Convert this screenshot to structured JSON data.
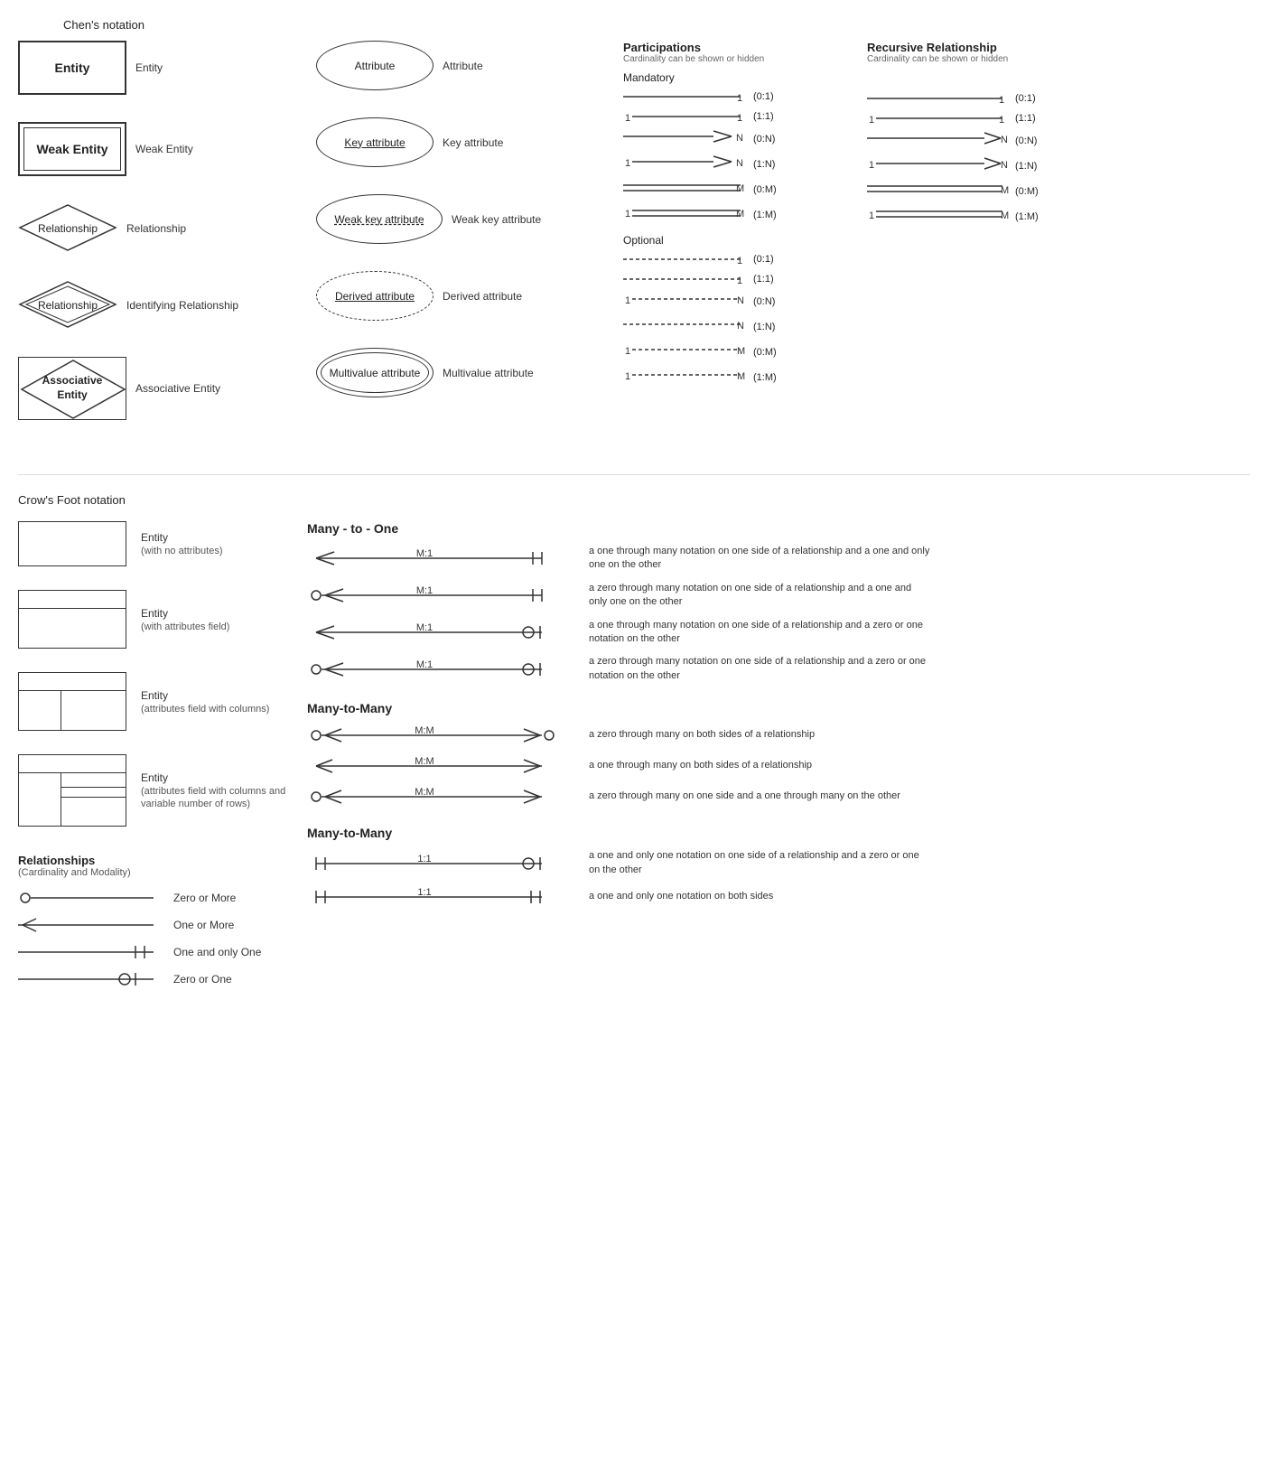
{
  "chens": {
    "header": "Chen's notation",
    "entities": [
      {
        "shape": "entity",
        "label": "Entity",
        "desc": "Entity"
      },
      {
        "shape": "weak-entity",
        "label": "Weak Entity",
        "desc": "Weak Entity"
      },
      {
        "shape": "diamond",
        "label": "Relationship",
        "desc": "Relationship"
      },
      {
        "shape": "diamond-double",
        "label": "Relationship",
        "desc": "Identifying Relationship"
      },
      {
        "shape": "assoc-entity",
        "label": "Associative\nEntity",
        "desc": "Associative Entity"
      }
    ],
    "attributes": [
      {
        "shape": "ellipse",
        "label": "Attribute",
        "desc": "Attribute"
      },
      {
        "shape": "ellipse-underline",
        "label": "Key attribute",
        "desc": "Key attribute"
      },
      {
        "shape": "ellipse-double-underline",
        "label": "Weak key attribute",
        "desc": "Weak key attribute"
      },
      {
        "shape": "ellipse-dashed",
        "label": "Derived attribute",
        "desc": "Derived attribute"
      },
      {
        "shape": "ellipse-multivalue",
        "label": "Multivalue attribute",
        "desc": "Multivalue attribute"
      }
    ]
  },
  "participations": {
    "header": "Participations",
    "subheader": "Cardinality can be shown or hidden",
    "mandatory_label": "Mandatory",
    "optional_label": "Optional",
    "rows_mandatory": [
      {
        "left": "",
        "right": "1",
        "notation": "(0:1)"
      },
      {
        "left": "1",
        "right": "1",
        "notation": "(1:1)"
      },
      {
        "left": "",
        "right": "N",
        "notation": "(0:N)"
      },
      {
        "left": "1",
        "right": "N",
        "notation": "(1:N)"
      },
      {
        "left": "",
        "right": "M",
        "notation": "(0:M)"
      },
      {
        "left": "1",
        "right": "M",
        "notation": "(1:M)"
      }
    ],
    "rows_optional": [
      {
        "left": "",
        "right": "1",
        "notation": "(0:1)"
      },
      {
        "left": "",
        "right": "1",
        "notation": "(1:1)"
      },
      {
        "left": "1",
        "right": "N",
        "notation": "(0:N)"
      },
      {
        "left": "",
        "right": "N",
        "notation": "(1:N)"
      },
      {
        "left": "1",
        "right": "M",
        "notation": "(0:M)"
      },
      {
        "left": "1",
        "right": "M",
        "notation": "(1:M)"
      }
    ]
  },
  "recursive": {
    "header": "Recursive Relationship",
    "subheader": "Cardinality can be shown or hidden",
    "rows": [
      {
        "right": "1",
        "notation": "(0:1)"
      },
      {
        "left": "1",
        "right": "1",
        "notation": "(1:1)"
      },
      {
        "right": "N",
        "notation": "(0:N)"
      },
      {
        "left": "1",
        "right": "N",
        "notation": "(1:N)"
      },
      {
        "right": "M",
        "notation": "(0:M)"
      },
      {
        "left": "1",
        "right": "M",
        "notation": "(1:M)"
      }
    ]
  },
  "crows_foot": {
    "header": "Crow's Foot notation",
    "entities": [
      {
        "type": "simple",
        "label": "Entity",
        "sublabel": "(with no attributes)"
      },
      {
        "type": "attr",
        "label": "Entity",
        "sublabel": "(with attributes field)"
      },
      {
        "type": "cols",
        "label": "Entity",
        "sublabel": "(attributes field with columns)"
      },
      {
        "type": "rows",
        "label": "Entity",
        "sublabel": "(attributes field with columns and variable number of rows)"
      }
    ],
    "many_to_one_title": "Many - to - One",
    "many_to_one": [
      {
        "label": "M:1",
        "desc": "a one through many notation on one side of a relationship and a one and only one on the other"
      },
      {
        "label": "M:1",
        "desc": "a zero through many notation on one side of a relationship and a one and only one on the other"
      },
      {
        "label": "M:1",
        "desc": "a one through many notation on one side of a relationship and a zero or one notation on the other"
      },
      {
        "label": "M:1",
        "desc": "a zero through many notation on one side of a relationship and a zero or one notation on the other"
      }
    ],
    "many_to_many_title": "Many-to-Many",
    "many_to_many": [
      {
        "label": "M:M",
        "desc": "a zero through many on both sides of a relationship"
      },
      {
        "label": "M:M",
        "desc": "a one through many on both sides of a relationship"
      },
      {
        "label": "M:M",
        "desc": "a zero through many on one side and a one through many on the other"
      }
    ],
    "many_to_many2_title": "Many-to-Many",
    "one_to_one": [
      {
        "label": "1:1",
        "desc": "a one and only one notation on one side of a relationship and a zero or one on the other"
      },
      {
        "label": "1:1",
        "desc": "a one and only one notation on both sides"
      }
    ],
    "relationships_title": "Relationships",
    "relationships_subtitle": "(Cardinality and Modality)",
    "rel_symbols": [
      {
        "symbol": "zero-or-more",
        "label": "Zero or More"
      },
      {
        "symbol": "one-or-more",
        "label": "One or More"
      },
      {
        "symbol": "one-and-only",
        "label": "One and only One"
      },
      {
        "symbol": "zero-or-one",
        "label": "Zero or One"
      }
    ]
  }
}
